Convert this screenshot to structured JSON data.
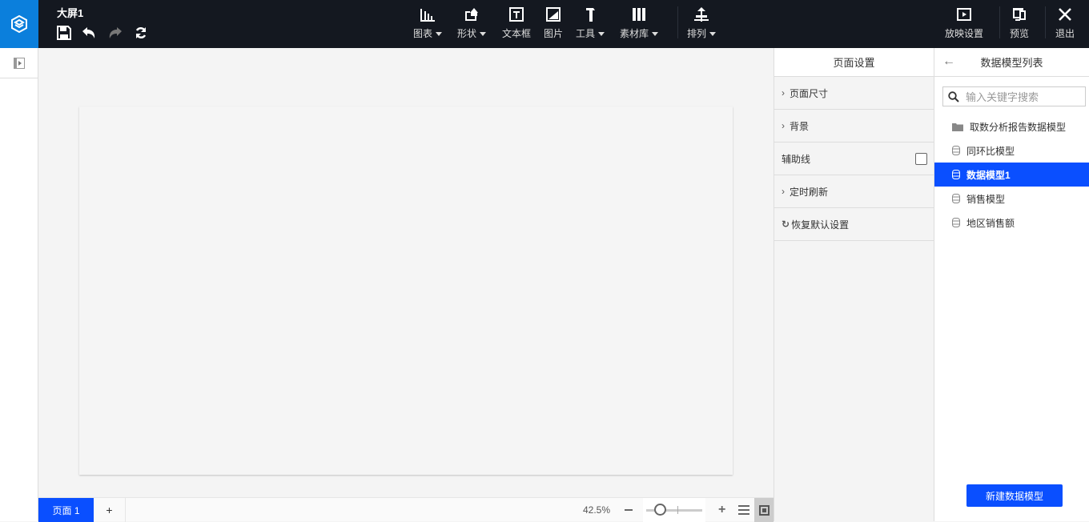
{
  "header": {
    "title": "大屏1",
    "tools": [
      {
        "label": "图表",
        "icon": "bar-chart-icon",
        "dropdown": true
      },
      {
        "label": "形状",
        "icon": "shape-icon",
        "dropdown": true
      },
      {
        "label": "文本框",
        "icon": "textbox-icon",
        "dropdown": false
      },
      {
        "label": "图片",
        "icon": "image-icon",
        "dropdown": false
      },
      {
        "label": "工具",
        "icon": "hammer-icon",
        "dropdown": true
      },
      {
        "label": "素材库",
        "icon": "library-icon",
        "dropdown": true
      },
      {
        "label": "排列",
        "icon": "arrange-icon",
        "dropdown": true
      }
    ],
    "right": {
      "play_settings": "放映设置",
      "preview": "预览",
      "exit": "退出"
    }
  },
  "bottom": {
    "page_tab": "页面 1",
    "add": "+",
    "zoom": "42.5%",
    "zoom_level_percent": 42.5
  },
  "settings": {
    "title": "页面设置",
    "page_size": "页面尺寸",
    "background": "背景",
    "guides": "辅助线",
    "refresh": "定时刷新",
    "reset": "恢复默认设置"
  },
  "models": {
    "title": "数据模型列表",
    "search_placeholder": "输入关键字搜索",
    "items": [
      {
        "label": "取数分析报告数据模型",
        "type": "folder"
      },
      {
        "label": "同环比模型",
        "type": "db"
      },
      {
        "label": "数据模型1",
        "type": "db",
        "active": true
      },
      {
        "label": "销售模型",
        "type": "db"
      },
      {
        "label": "地区销售额",
        "type": "db"
      }
    ],
    "new_button": "新建数据模型"
  },
  "colors": {
    "accent": "#0a4fff",
    "header": "#141820",
    "logo": "#0b7fdc"
  }
}
